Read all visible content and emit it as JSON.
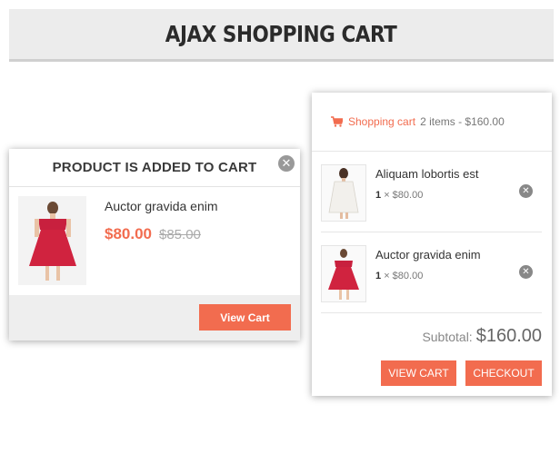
{
  "header": {
    "title": "AJAX SHOPPING CART"
  },
  "popup": {
    "title": "PRODUCT IS ADDED TO CART",
    "close_icon": "close-icon",
    "product": {
      "name": "Auctor gravida enim",
      "price": "$80.00",
      "old_price": "$85.00"
    },
    "view_cart_label": "View Cart"
  },
  "cart": {
    "icon": "shopping-cart-icon",
    "link_label": "Shopping cart",
    "summary": "2 items - $160.00",
    "items": [
      {
        "name": "Aliquam lobortis est",
        "qty": "1",
        "price": "× $80.00"
      },
      {
        "name": "Auctor gravida enim",
        "qty": "1",
        "price": "× $80.00"
      }
    ],
    "subtotal_label": "Subtotal:",
    "subtotal_value": "$160.00",
    "view_cart_label": "VIEW CART",
    "checkout_label": "CHECKOUT"
  },
  "colors": {
    "accent": "#f26c4f",
    "header_bg": "#ececec",
    "footer_bg": "#eeeeee"
  }
}
